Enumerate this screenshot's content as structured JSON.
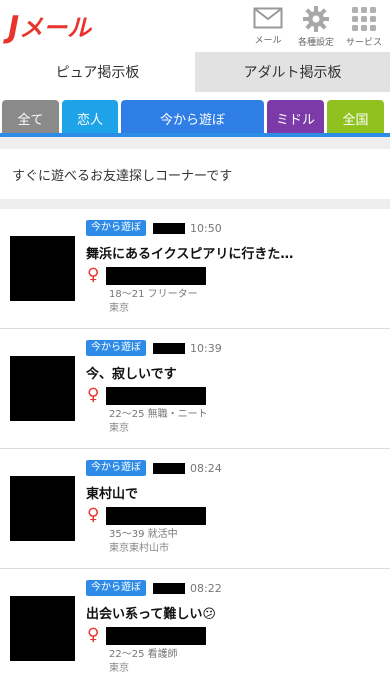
{
  "header": {
    "logo_main": "J",
    "logo_rest": "メール",
    "icons": [
      {
        "name": "mail-icon",
        "label": "メール"
      },
      {
        "name": "gear-icon",
        "label": "各種設定"
      },
      {
        "name": "grid-icon",
        "label": "サービス"
      }
    ]
  },
  "board_tabs": [
    {
      "label": "ピュア掲示板",
      "active": true
    },
    {
      "label": "アダルト掲示板",
      "active": false
    }
  ],
  "category_tabs": [
    {
      "label": "全て",
      "color": "#8a8a8a"
    },
    {
      "label": "恋人",
      "color": "#1ea2e8"
    },
    {
      "label": "今から遊ぼ",
      "color": "#2e7ee6"
    },
    {
      "label": "ミドル",
      "color": "#7b3aa8"
    },
    {
      "label": "全国",
      "color": "#8fc21f"
    }
  ],
  "intro_text": "すぐに遊べるお友達探しコーナーです",
  "posts": [
    {
      "badge": "今から遊ぼ",
      "time": "10:50",
      "title": "舞浜にあるイクスピアリに行きた…",
      "gender": "♀",
      "age_job": "18～21 フリーター",
      "area": "東京"
    },
    {
      "badge": "今から遊ぼ",
      "time": "10:39",
      "title": "今、寂しいです",
      "gender": "♀",
      "age_job": "22～25 無職・ニート",
      "area": "東京"
    },
    {
      "badge": "今から遊ぼ",
      "time": "08:24",
      "title": "東村山で",
      "gender": "♀",
      "age_job": "35～39 就活中",
      "area": "東京東村山市"
    },
    {
      "badge": "今から遊ぼ",
      "time": "08:22",
      "title": "出会い系って難しい😕",
      "gender": "♀",
      "age_job": "22～25 看護師",
      "area": "東京"
    }
  ]
}
